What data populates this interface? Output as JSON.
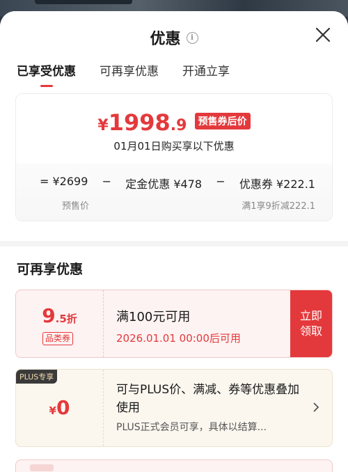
{
  "sheet": {
    "title": "优惠",
    "info_icon": "info-icon",
    "close_icon": "close-icon"
  },
  "tabs": [
    {
      "label": "已享受优惠",
      "active": true
    },
    {
      "label": "可再享优惠",
      "active": false
    },
    {
      "label": "开通立享",
      "active": false
    }
  ],
  "price_summary": {
    "currency": "¥",
    "price_int": "1998",
    "price_dec": ".9",
    "badge": "预售券后价",
    "date_note": "01月01日购买享以下优惠",
    "formula": [
      "=  ¥2699",
      "−",
      "定金优惠 ¥478",
      "−",
      "优惠券 ¥222.1"
    ],
    "base_label": "预售价",
    "coupon_rule": "满1享9折减222.1"
  },
  "more_offers": {
    "section_title": "可再享优惠",
    "coupon": {
      "discount_big": "9",
      "discount_small": ".5折",
      "category": "品类券",
      "condition": "满100元可用",
      "valid_from": "2026.01.01 00:00后可用",
      "claim_line1": "立即",
      "claim_line2": "领取"
    },
    "plus": {
      "tag": "PLUS专享",
      "currency": "¥",
      "price": "0",
      "description": "可与PLUS价、满减、券等优惠叠加使用",
      "note": "PLUS正式会员可享，具体以结算..."
    }
  },
  "colors": {
    "accent": "#e4393c",
    "plus_tag_bg": "#3a3a3a",
    "plus_tag_text": "#f3dcb1"
  }
}
